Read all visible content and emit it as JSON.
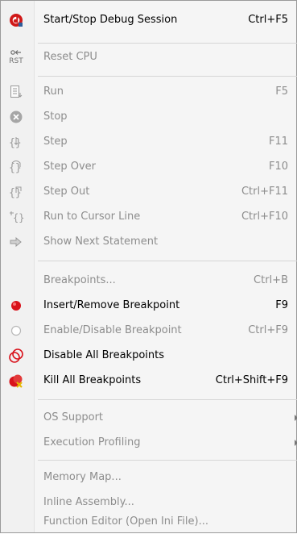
{
  "items": [
    {
      "label": "Start/Stop Debug Session",
      "shortcut": "Ctrl+F5",
      "icon": "debug-session-icon"
    },
    {
      "label": "Reset CPU",
      "icon": "reset-cpu-icon",
      "icon_text": "RST"
    },
    {
      "label": "Run",
      "shortcut": "F5",
      "icon": "run-icon"
    },
    {
      "label": "Stop",
      "icon": "stop-icon"
    },
    {
      "label": "Step",
      "shortcut": "F11",
      "icon": "step-icon"
    },
    {
      "label": "Step Over",
      "shortcut": "F10",
      "icon": "step-over-icon"
    },
    {
      "label": "Step Out",
      "shortcut": "Ctrl+F11",
      "icon": "step-out-icon"
    },
    {
      "label": "Run to Cursor Line",
      "shortcut": "Ctrl+F10",
      "icon": "run-to-cursor-icon"
    },
    {
      "label": "Show Next Statement",
      "icon": "show-next-statement-icon"
    },
    {
      "label": "Breakpoints...",
      "shortcut": "Ctrl+B"
    },
    {
      "label": "Insert/Remove Breakpoint",
      "shortcut": "F9",
      "icon": "insert-breakpoint-icon"
    },
    {
      "label": "Enable/Disable Breakpoint",
      "shortcut": "Ctrl+F9",
      "icon": "enable-breakpoint-icon"
    },
    {
      "label": "Disable All Breakpoints",
      "icon": "disable-all-breakpoints-icon"
    },
    {
      "label": "Kill All Breakpoints",
      "shortcut": "Ctrl+Shift+F9",
      "icon": "kill-all-breakpoints-icon"
    },
    {
      "label": "OS Support",
      "icon": "submenu-arrow-icon"
    },
    {
      "label": "Execution Profiling",
      "icon": "submenu-arrow-icon"
    },
    {
      "label": "Memory Map..."
    },
    {
      "label": "Inline Assembly..."
    },
    {
      "label": "Function Editor (Open Ini File)..."
    }
  ],
  "colors": {
    "enabled_text": "#000000",
    "disabled_text": "#8d8d8d",
    "breakpoint_red": "#d9121b"
  }
}
